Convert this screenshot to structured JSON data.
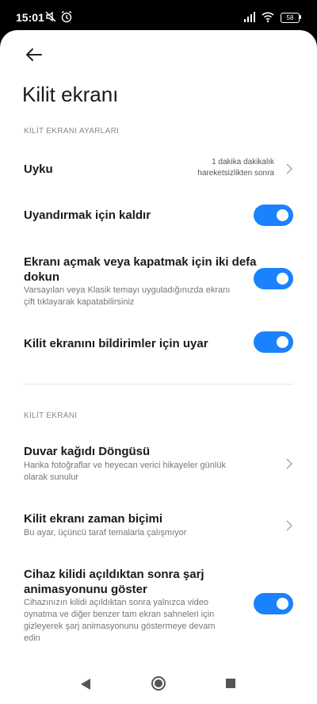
{
  "status": {
    "time": "15:01",
    "battery": "58"
  },
  "page": {
    "title": "Kilit ekranı"
  },
  "section1": {
    "header": "KİLİT EKRANI AYARLARI",
    "sleep": {
      "title": "Uyku",
      "value_line1": "1 dakika dakikalık",
      "value_line2": "hareketsizlikten sonra"
    },
    "raise": {
      "title": "Uyandırmak için kaldır",
      "enabled": true
    },
    "doubletap": {
      "title_line1": "Ekranı açmak veya kapatmak için iki defa",
      "title_line2": "dokun",
      "sub_line1": "Varsayılan veya Klasik temayı uyguladığınızda ekranı",
      "sub_line2": "çift tıklayarak kapatabilirsiniz",
      "enabled": true
    },
    "notify": {
      "title": "Kilit ekranını bildirimler için uyar",
      "enabled": true
    }
  },
  "section2": {
    "header": "KİLİT EKRANI",
    "wallpaper": {
      "title": "Duvar kağıdı Döngüsü",
      "sub_line1": "Harika fotoğraflar ve heyecan verici hikayeler günlük",
      "sub_line2": "olarak sunulur"
    },
    "timeformat": {
      "title": "Kilit ekranı zaman biçimi",
      "sub": "Bu ayar, üçüncü taraf temalarla çalışmıyor"
    },
    "charging": {
      "title_line1": "Cihaz kilidi açıldıktan sonra şarj",
      "title_line2": "animasyonunu göster",
      "sub_line1": "Cihazınızın kilidi açıldıktan sonra yalnızca video",
      "sub_line2": "oynatma ve diğer benzer tam ekran sahneleri için",
      "sub_line3": "gizleyerek şarj animasyonunu göstermeye devam",
      "sub_line4": "edin",
      "enabled": true
    }
  },
  "colors": {
    "accent": "#1a82ff"
  },
  "icons": {
    "back": "arrow-left-icon",
    "chevron": "chevron-right-icon",
    "nav_back": "triangle-back-icon",
    "nav_home": "circle-home-icon",
    "nav_recents": "square-recents-icon"
  }
}
